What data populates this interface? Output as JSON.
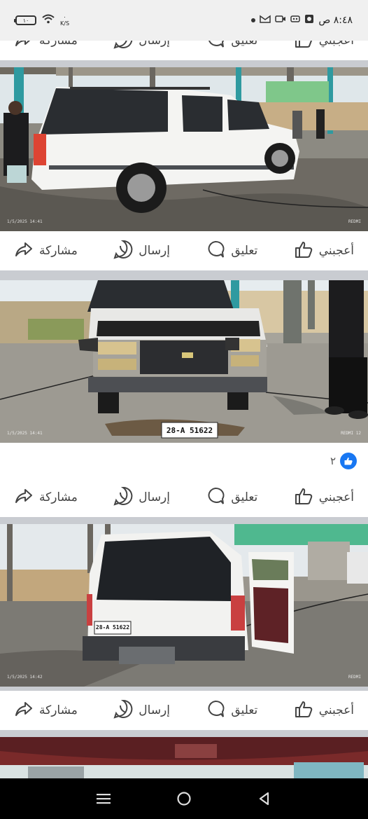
{
  "status_bar": {
    "time": "٨:٤٨ ص",
    "battery": "١٠",
    "net_speed_value": "٠",
    "net_speed_unit": "K/S"
  },
  "actions": {
    "like": "أعجبني",
    "comment": "تعليق",
    "send": "إرسال",
    "share": "مشاركة"
  },
  "posts": [
    {
      "photo_date": "1/5/2025 14:41",
      "photo_brand": "REDMI",
      "plate": ""
    },
    {
      "photo_date": "1/5/2025 14:41",
      "photo_brand": "REDMI 12",
      "plate": "28-A 51622",
      "reaction_count": "٢"
    },
    {
      "photo_date": "1/5/2025 14:42",
      "photo_brand": "REDMI",
      "plate": "28-A 51622"
    }
  ],
  "icons": {
    "like": "thumbs-up-icon",
    "comment": "comment-bubble-icon",
    "send": "whatsapp-icon",
    "share": "share-arrow-icon"
  },
  "colors": {
    "facebook_blue": "#1877f2",
    "action_text": "#444444",
    "feed_bg": "#c9ccd1"
  }
}
